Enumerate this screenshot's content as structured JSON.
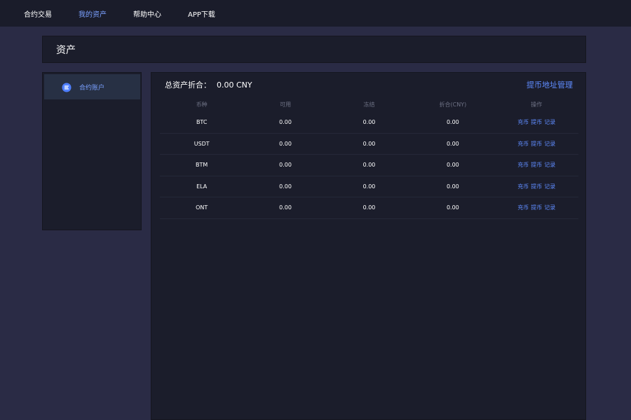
{
  "nav": {
    "items": [
      {
        "label": "合约交易",
        "active": false
      },
      {
        "label": "我的资产",
        "active": true
      },
      {
        "label": "帮助中心",
        "active": false
      },
      {
        "label": "APP下载",
        "active": false
      }
    ]
  },
  "page": {
    "title": "资产"
  },
  "sidebar": {
    "items": [
      {
        "label": "合约账户",
        "icon": "wallet-icon",
        "active": true
      }
    ]
  },
  "summary": {
    "label": "总资产折合：",
    "value": "0.00 CNY",
    "manage_link": "提币地址管理"
  },
  "table": {
    "headers": [
      "币种",
      "可用",
      "冻结",
      "折合(CNY)",
      "操作"
    ],
    "rows": [
      {
        "coin": "BTC",
        "available": "0.00",
        "frozen": "0.00",
        "cny": "0.00"
      },
      {
        "coin": "USDT",
        "available": "0.00",
        "frozen": "0.00",
        "cny": "0.00"
      },
      {
        "coin": "BTM",
        "available": "0.00",
        "frozen": "0.00",
        "cny": "0.00"
      },
      {
        "coin": "ELA",
        "available": "0.00",
        "frozen": "0.00",
        "cny": "0.00"
      },
      {
        "coin": "ONT",
        "available": "0.00",
        "frozen": "0.00",
        "cny": "0.00"
      }
    ],
    "actions": [
      "充币",
      "提币",
      "记录"
    ]
  },
  "colors": {
    "accent": "#5f8cff",
    "active_nav": "#7aa0ff",
    "background": "#2a2b45",
    "panel": "#1b1d2b"
  }
}
